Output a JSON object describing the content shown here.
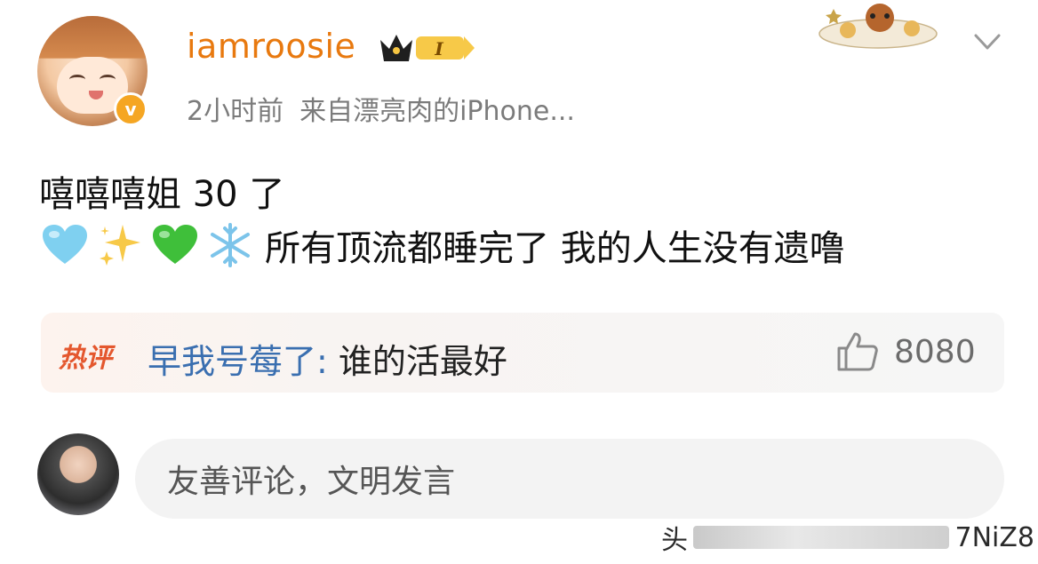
{
  "post": {
    "username": "iamroosie",
    "vip_level": "I",
    "time": "2小时前",
    "source": "来自漂亮肉的iPhone...",
    "line1": "嘻嘻嘻姐 30 了",
    "line2_emojis": [
      "light-blue-heart",
      "sparkles",
      "green-heart",
      "snowflake"
    ],
    "line2_text": "所有顶流都睡完了 我的人生没有遗噜"
  },
  "hot_comment": {
    "badge": "热评",
    "user": "早我号莓了",
    "separator": ": ",
    "text": "谁的活最好",
    "likes": "8080"
  },
  "comment_input": {
    "placeholder": "友善评论，文明发言"
  },
  "watermark": {
    "prefix": "头",
    "suffix": "7NiZ8"
  },
  "colors": {
    "username": "#e8790f",
    "hot_user": "#3a6fb0",
    "hot_badge": "#e4572e",
    "meta": "#7b7b7b"
  }
}
